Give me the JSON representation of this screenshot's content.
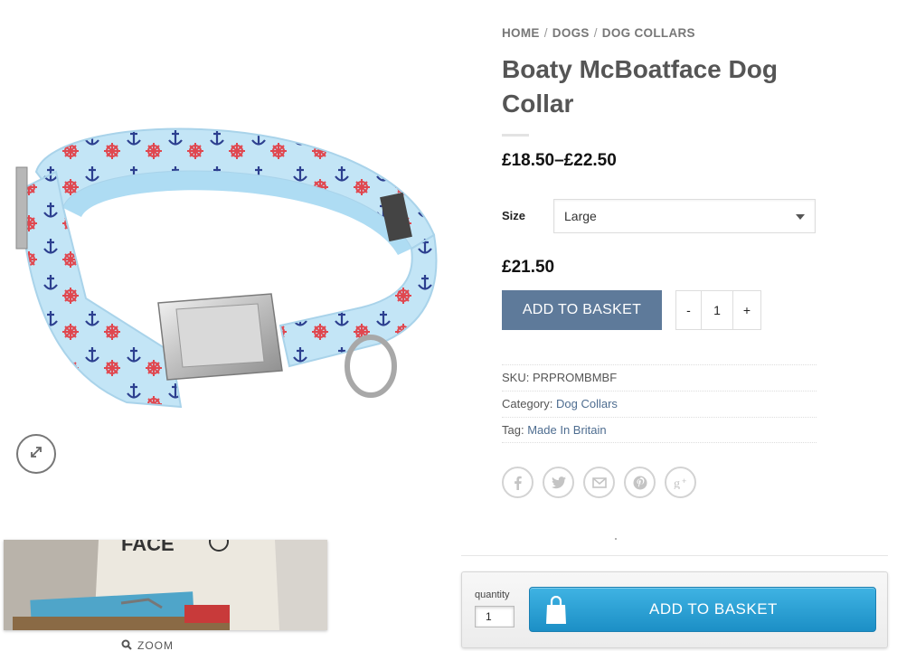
{
  "breadcrumb": {
    "items": [
      "HOME",
      "DOGS",
      "DOG COLLARS"
    ],
    "separator": "/"
  },
  "product": {
    "title": "Boaty McBoatface Dog Collar",
    "price_range": "£18.50–£22.50",
    "variation_price": "£21.50",
    "size_label": "Size",
    "size_selected": "Large",
    "add_to_basket_label": "ADD TO BASKET",
    "quantity": {
      "minus": "-",
      "value": "1",
      "plus": "+"
    }
  },
  "meta": {
    "sku_label": "SKU:",
    "sku": "PRPROMBMBF",
    "category_label": "Category:",
    "category": "Dog Collars",
    "tag_label": "Tag:",
    "tag": "Made In Britain"
  },
  "gallery": {
    "zoom_label": "ZOOM",
    "thumbnail_caption": "FACE"
  },
  "share": [
    "facebook-icon",
    "twitter-icon",
    "email-icon",
    "pinterest-icon",
    "google-plus-icon"
  ],
  "sticky_bar": {
    "quantity_label": "quantity",
    "quantity_value": "1",
    "add_to_basket_label": "ADD TO BASKET"
  },
  "colors": {
    "add_button": "#5e7a9a",
    "link": "#4e6d90",
    "sticky_button": "#1c8fc6",
    "collar_fabric": "#bfe3f5",
    "collar_print_red": "#e0474f",
    "collar_print_blue": "#2c3f8f"
  }
}
